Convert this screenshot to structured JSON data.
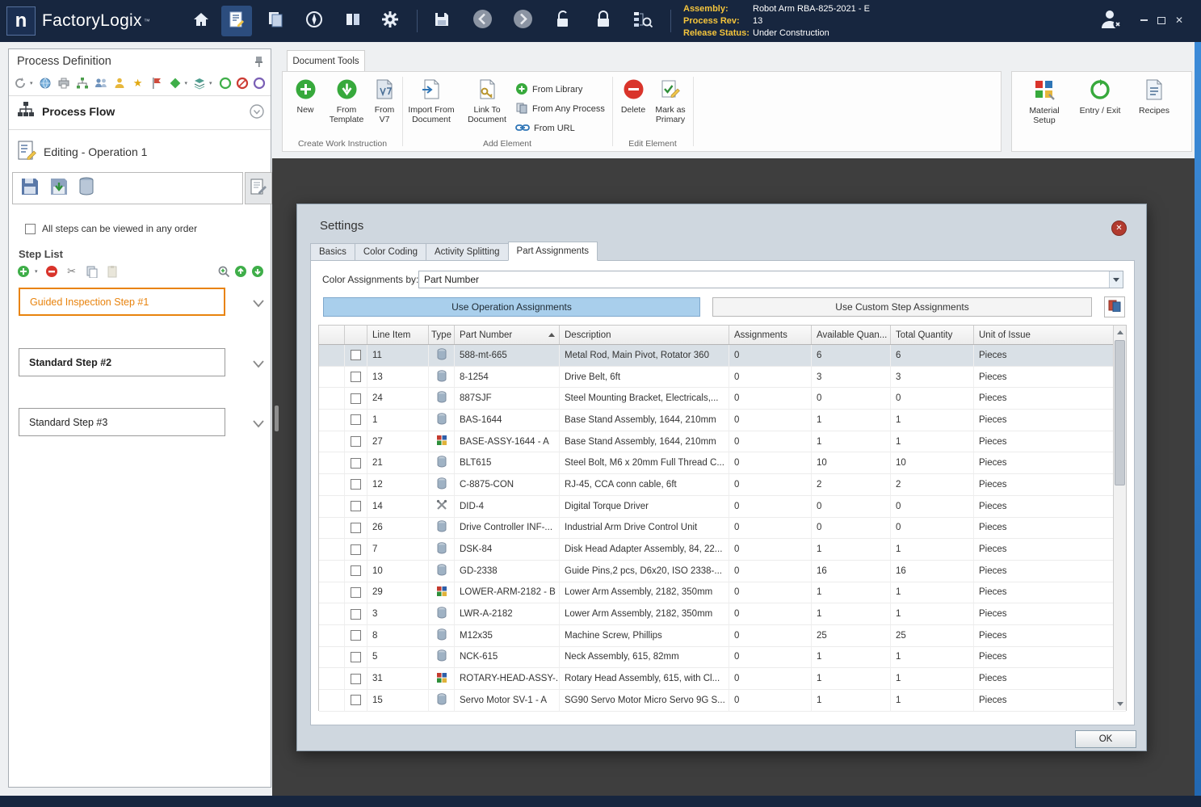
{
  "titlebar": {
    "logo_letter": "n",
    "brand": "FactoryLogix",
    "brand_tm": "™",
    "assembly": {
      "label": "Assembly:",
      "value": "Robot Arm RBA-825-2021 - E"
    },
    "process_rev": {
      "label": "Process Rev:",
      "value": "13"
    },
    "release_status": {
      "label": "Release Status:",
      "value": "Under Construction"
    }
  },
  "left_panel": {
    "title": "Process Definition",
    "process_flow_label": "Process Flow",
    "editing_label": "Editing - Operation 1",
    "order_checkbox_label": "All steps can be viewed in any order",
    "order_checkbox_checked": false,
    "step_list_title": "Step List",
    "steps": [
      {
        "label": "Guided Inspection Step #1",
        "selected": true
      },
      {
        "label": "Standard Step #2",
        "selected": false
      },
      {
        "label": "Standard Step #3",
        "selected": false
      }
    ]
  },
  "ribbon": {
    "tab_label": "Document Tools",
    "create_group": {
      "label": "Create Work Instruction",
      "new": "New",
      "from_template": "From Template",
      "from_v7": "From V7"
    },
    "add_group": {
      "label": "Add Element",
      "import_from_document": "Import From Document",
      "link_to_document": "Link To Document",
      "from_library": "From Library",
      "from_any_process": "From Any Process",
      "from_url": "From URL"
    },
    "edit_group": {
      "label": "Edit Element",
      "delete": "Delete",
      "mark_as_primary": "Mark as Primary"
    },
    "right_items": {
      "material_setup": "Material Setup",
      "entry_exit": "Entry / Exit",
      "recipes": "Recipes"
    }
  },
  "dialog": {
    "title": "Settings",
    "tabs": [
      {
        "label": "Basics"
      },
      {
        "label": "Color Coding"
      },
      {
        "label": "Activity Splitting"
      },
      {
        "label": "Part Assignments",
        "active": true
      }
    ],
    "color_assignments_label": "Color Assignments by:",
    "color_assignments_value": "Part Number",
    "use_operation_btn": "Use Operation Assignments",
    "use_custom_btn": "Use Custom Step Assignments",
    "ok_label": "OK",
    "table": {
      "columns": [
        "Line Item",
        "Type",
        "Part Number",
        "Description",
        "Assignments",
        "Available Quan...",
        "Total Quantity",
        "Unit of Issue"
      ],
      "sort_column": "Part Number",
      "sort_direction": "asc",
      "rows": [
        {
          "line": "11",
          "type": "part",
          "part": "588-mt-665",
          "desc": "Metal Rod, Main Pivot, Rotator 360",
          "assignments": "0",
          "available": "6",
          "total": "6",
          "unit": "Pieces",
          "selected": true
        },
        {
          "line": "13",
          "type": "part",
          "part": "8-1254",
          "desc": "Drive Belt, 6ft",
          "assignments": "0",
          "available": "3",
          "total": "3",
          "unit": "Pieces",
          "selected": false
        },
        {
          "line": "24",
          "type": "part",
          "part": "887SJF",
          "desc": "Steel Mounting Bracket, Electricals,...",
          "assignments": "0",
          "available": "0",
          "total": "0",
          "unit": "Pieces",
          "selected": false
        },
        {
          "line": "1",
          "type": "part",
          "part": "BAS-1644",
          "desc": "Base Stand Assembly, 1644, 210mm",
          "assignments": "0",
          "available": "1",
          "total": "1",
          "unit": "Pieces",
          "selected": false
        },
        {
          "line": "27",
          "type": "assembly",
          "part": "BASE-ASSY-1644 - A",
          "desc": "Base Stand Assembly, 1644, 210mm",
          "assignments": "0",
          "available": "1",
          "total": "1",
          "unit": "Pieces",
          "selected": false
        },
        {
          "line": "21",
          "type": "part",
          "part": "BLT615",
          "desc": "Steel Bolt, M6 x 20mm Full Thread C...",
          "assignments": "0",
          "available": "10",
          "total": "10",
          "unit": "Pieces",
          "selected": false
        },
        {
          "line": "12",
          "type": "part",
          "part": "C-8875-CON",
          "desc": "RJ-45, CCA conn cable, 6ft",
          "assignments": "0",
          "available": "2",
          "total": "2",
          "unit": "Pieces",
          "selected": false
        },
        {
          "line": "14",
          "type": "tool",
          "part": "DID-4",
          "desc": "Digital Torque Driver",
          "assignments": "0",
          "available": "0",
          "total": "0",
          "unit": "Pieces",
          "selected": false
        },
        {
          "line": "26",
          "type": "part",
          "part": "Drive Controller INF-...",
          "desc": "Industrial Arm Drive Control Unit",
          "assignments": "0",
          "available": "0",
          "total": "0",
          "unit": "Pieces",
          "selected": false
        },
        {
          "line": "7",
          "type": "part",
          "part": "DSK-84",
          "desc": "Disk Head Adapter Assembly, 84, 22...",
          "assignments": "0",
          "available": "1",
          "total": "1",
          "unit": "Pieces",
          "selected": false
        },
        {
          "line": "10",
          "type": "part",
          "part": "GD-2338",
          "desc": "Guide Pins,2 pcs, D6x20, ISO 2338-...",
          "assignments": "0",
          "available": "16",
          "total": "16",
          "unit": "Pieces",
          "selected": false
        },
        {
          "line": "29",
          "type": "assembly",
          "part": "LOWER-ARM-2182 - B",
          "desc": "Lower Arm Assembly, 2182, 350mm",
          "assignments": "0",
          "available": "1",
          "total": "1",
          "unit": "Pieces",
          "selected": false
        },
        {
          "line": "3",
          "type": "part",
          "part": "LWR-A-2182",
          "desc": "Lower Arm Assembly, 2182, 350mm",
          "assignments": "0",
          "available": "1",
          "total": "1",
          "unit": "Pieces",
          "selected": false
        },
        {
          "line": "8",
          "type": "part",
          "part": "M12x35",
          "desc": "Machine Screw, Phillips",
          "assignments": "0",
          "available": "25",
          "total": "25",
          "unit": "Pieces",
          "selected": false
        },
        {
          "line": "5",
          "type": "part",
          "part": "NCK-615",
          "desc": "Neck Assembly, 615, 82mm",
          "assignments": "0",
          "available": "1",
          "total": "1",
          "unit": "Pieces",
          "selected": false
        },
        {
          "line": "31",
          "type": "assembly",
          "part": "ROTARY-HEAD-ASSY-...",
          "desc": "Rotary Head Assembly, 615, with Cl...",
          "assignments": "0",
          "available": "1",
          "total": "1",
          "unit": "Pieces",
          "selected": false
        },
        {
          "line": "15",
          "type": "part",
          "part": "Servo Motor SV-1 - A",
          "desc": "SG90 Servo Motor Micro Servo 9G S...",
          "assignments": "0",
          "available": "1",
          "total": "1",
          "unit": "Pieces",
          "selected": false
        }
      ]
    }
  },
  "colors": {
    "titlebar": "#17263f",
    "accent_yellow": "#f5c53c",
    "step_orange": "#e8830d",
    "selected_button_blue": "#a9cfec",
    "content_dark": "#3e3e3e",
    "dialog_bg": "#cfd7df",
    "selected_row": "#d9e0e6"
  }
}
